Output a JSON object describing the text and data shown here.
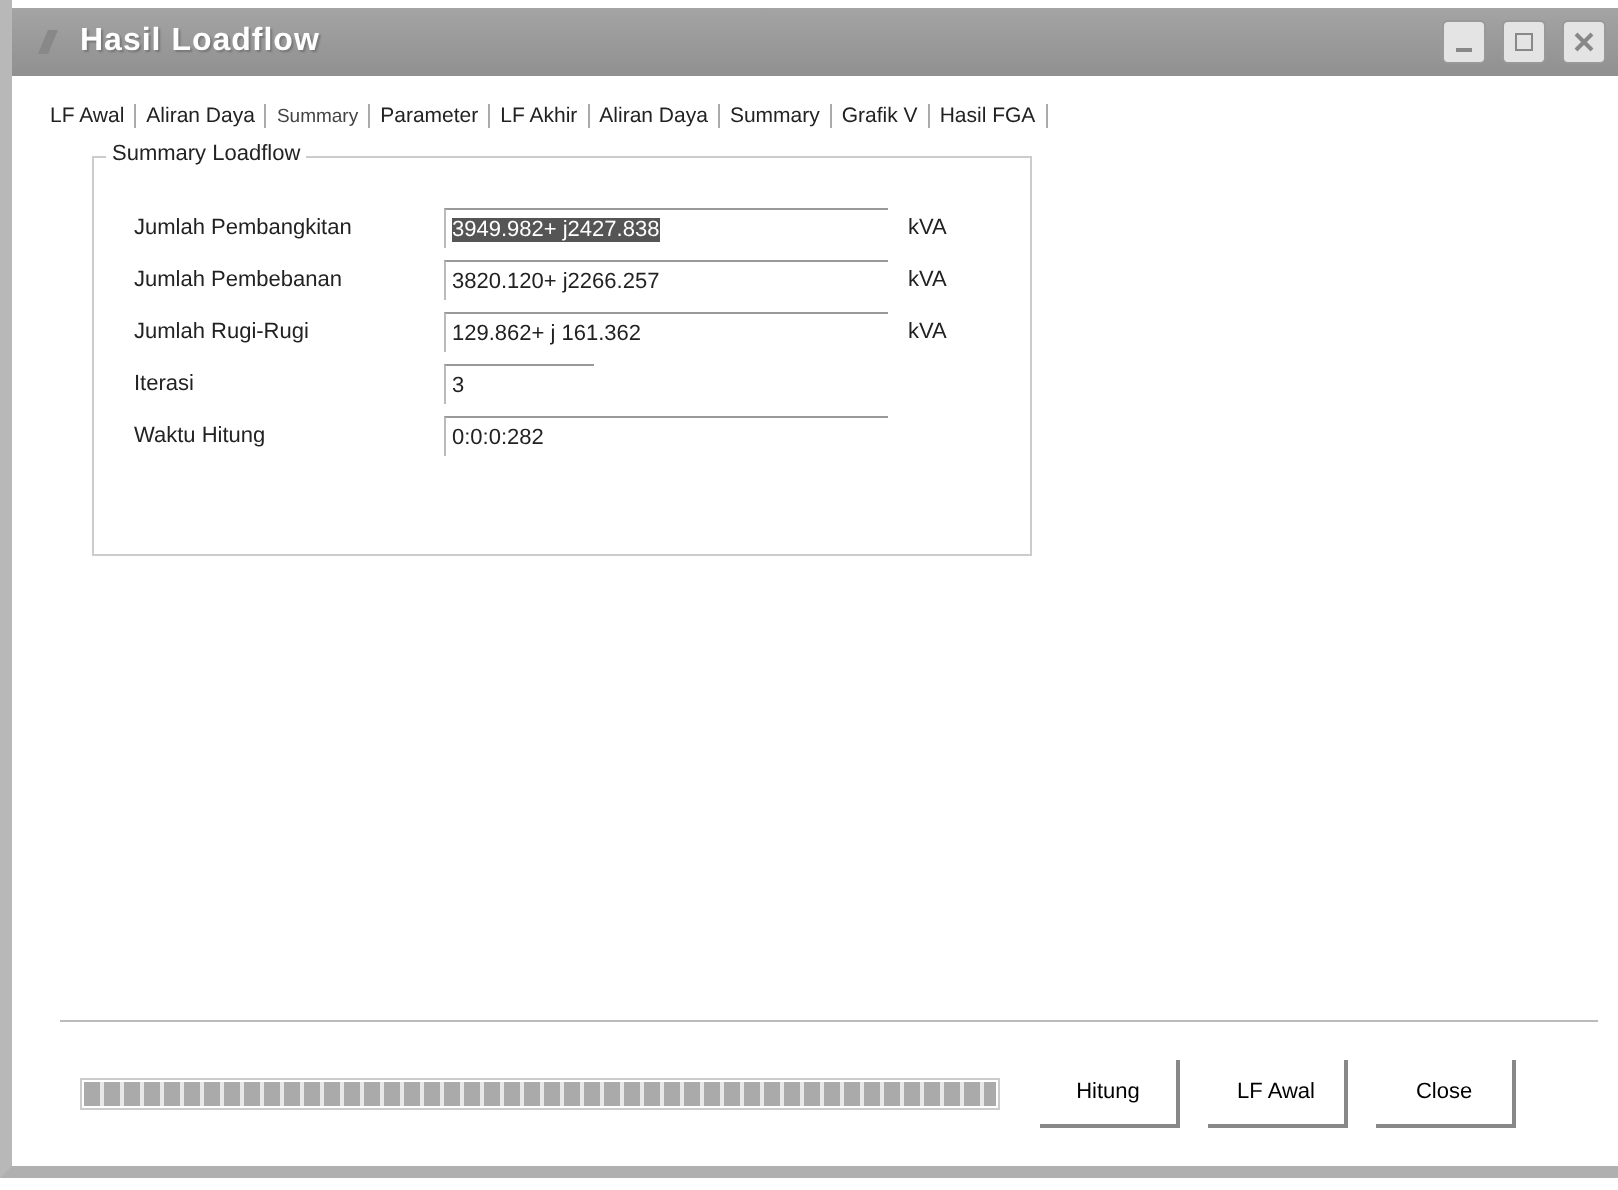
{
  "window": {
    "title": "Hasil Loadflow"
  },
  "tabs": [
    {
      "label": "LF Awal",
      "selected": false
    },
    {
      "label": "Aliran Daya",
      "selected": false
    },
    {
      "label": "Summary",
      "selected": true
    },
    {
      "label": "Parameter",
      "selected": false
    },
    {
      "label": "LF Akhir",
      "selected": false
    },
    {
      "label": "Aliran Daya",
      "selected": false
    },
    {
      "label": "Summary",
      "selected": false
    },
    {
      "label": "Grafik V",
      "selected": false
    },
    {
      "label": "Hasil FGA",
      "selected": false
    }
  ],
  "group": {
    "title": "Summary Loadflow",
    "fields": [
      {
        "label": "Jumlah Pembangkitan",
        "value": "3949.982+ j2427.838",
        "unit": "kVA",
        "highlighted": true,
        "kind": "wide"
      },
      {
        "label": "Jumlah Pembebanan",
        "value": "3820.120+ j2266.257",
        "unit": "kVA",
        "highlighted": false,
        "kind": "wide"
      },
      {
        "label": "Jumlah Rugi-Rugi",
        "value": "129.862+ j 161.362",
        "unit": "kVA",
        "highlighted": false,
        "kind": "wide"
      },
      {
        "label": "Iterasi",
        "value": "3",
        "highlighted": false,
        "kind": "short"
      },
      {
        "label": "Waktu Hitung",
        "value": "0:0:0:282",
        "highlighted": false,
        "kind": "wide"
      }
    ]
  },
  "progress": {
    "level": 1
  },
  "buttons": [
    "Hitung",
    "LF Awal",
    "Close"
  ]
}
